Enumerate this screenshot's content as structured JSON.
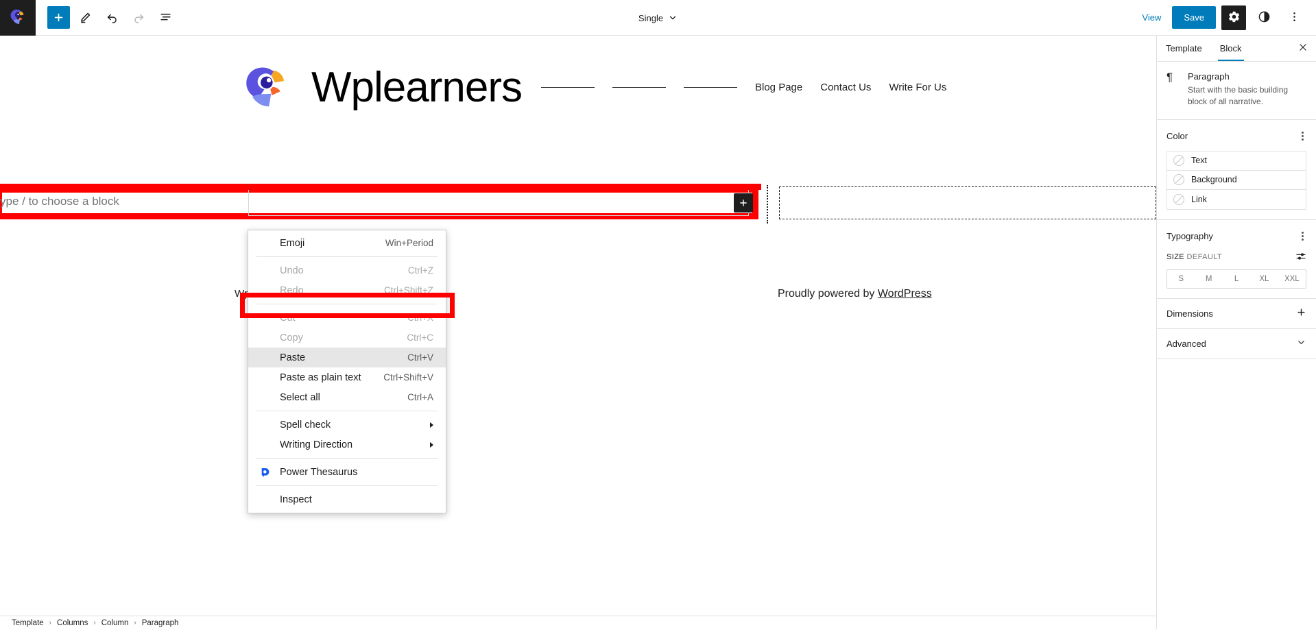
{
  "topbar": {
    "wp_logo_icon": "wordpress-bird-logo-icon",
    "add_block_label": "+",
    "tools": [
      {
        "name": "add-block-button",
        "icon": "plus-icon"
      },
      {
        "name": "edit-tools-button",
        "icon": "pencil-icon"
      },
      {
        "name": "undo-button",
        "icon": "undo-arrow-icon"
      },
      {
        "name": "redo-button",
        "icon": "redo-arrow-icon"
      },
      {
        "name": "list-view-button",
        "icon": "list-view-icon"
      }
    ],
    "document_title": "Single",
    "document_chevron_icon": "chevron-down-icon",
    "view_label": "View",
    "save_label": "Save",
    "settings_icon": "gear-icon",
    "styles_icon": "contrast-half-circle-icon",
    "options_icon": "vertical-ellipsis-icon"
  },
  "site": {
    "logo_icon": "parrot-logo-icon",
    "title": "Wplearners",
    "nav_dashes": 3,
    "nav_links": [
      "Blog Page",
      "Contact Us",
      "Write For Us"
    ]
  },
  "editor": {
    "block_placeholder": "ype / to choose a block",
    "block_appender_icon": "plus-icon",
    "hidden_paragraph_text": "Wp",
    "powered_by_prefix": "Proudly powered by ",
    "powered_by_link": "WordPress",
    "column_divider_name": "column-divider",
    "empty_column_name": "empty-column-placeholder"
  },
  "context_menu": {
    "items": [
      {
        "label": "Emoji",
        "accel": "Win+Period",
        "state": "normal",
        "icon": null,
        "submenu": false,
        "sep_after": true
      },
      {
        "label": "Undo",
        "accel": "Ctrl+Z",
        "state": "disabled",
        "icon": null,
        "submenu": false,
        "sep_after": false
      },
      {
        "label": "Redo",
        "accel": "Ctrl+Shift+Z",
        "state": "disabled",
        "icon": null,
        "submenu": false,
        "sep_after": true
      },
      {
        "label": "Cut",
        "accel": "Ctrl+X",
        "state": "disabled",
        "icon": null,
        "submenu": false,
        "sep_after": false
      },
      {
        "label": "Copy",
        "accel": "Ctrl+C",
        "state": "disabled",
        "icon": null,
        "submenu": false,
        "sep_after": false
      },
      {
        "label": "Paste",
        "accel": "Ctrl+V",
        "state": "active",
        "icon": null,
        "submenu": false,
        "sep_after": false
      },
      {
        "label": "Paste as plain text",
        "accel": "Ctrl+Shift+V",
        "state": "normal",
        "icon": null,
        "submenu": false,
        "sep_after": false
      },
      {
        "label": "Select all",
        "accel": "Ctrl+A",
        "state": "normal",
        "icon": null,
        "submenu": false,
        "sep_after": true
      },
      {
        "label": "Spell check",
        "accel": "",
        "state": "normal",
        "icon": null,
        "submenu": true,
        "sep_after": false
      },
      {
        "label": "Writing Direction",
        "accel": "",
        "state": "normal",
        "icon": null,
        "submenu": true,
        "sep_after": true
      },
      {
        "label": "Power Thesaurus",
        "accel": "",
        "state": "normal",
        "icon": "power-thesaurus-icon",
        "submenu": false,
        "sep_after": true
      },
      {
        "label": "Inspect",
        "accel": "",
        "state": "normal",
        "icon": null,
        "submenu": false,
        "sep_after": false
      }
    ]
  },
  "sidebar": {
    "tabs": [
      {
        "label": "Template",
        "selected": false
      },
      {
        "label": "Block",
        "selected": true
      }
    ],
    "close_icon": "close-x-icon",
    "block": {
      "icon": "paragraph-pilcrow-icon",
      "title": "Paragraph",
      "description": "Start with the basic building block of all narrative."
    },
    "color": {
      "title": "Color",
      "options_icon": "vertical-ellipsis-icon",
      "rows": [
        {
          "label": "Text",
          "swatch": "none"
        },
        {
          "label": "Background",
          "swatch": "none"
        },
        {
          "label": "Link",
          "swatch": "none"
        }
      ]
    },
    "typography": {
      "title": "Typography",
      "options_icon": "vertical-ellipsis-icon",
      "size_label": "SIZE",
      "size_value": "DEFAULT",
      "size_settings_icon": "sliders-icon",
      "sizes": [
        "S",
        "M",
        "L",
        "XL",
        "XXL"
      ]
    },
    "dimensions": {
      "title": "Dimensions",
      "icon": "plus-icon"
    },
    "advanced": {
      "title": "Advanced",
      "icon": "chevron-down-icon"
    }
  },
  "breadcrumb": {
    "separator": "›",
    "items": [
      "Template",
      "Columns",
      "Column",
      "Paragraph"
    ]
  },
  "colors": {
    "accent": "#007cba",
    "highlight": "#ff0000",
    "dark": "#1e1e1e"
  }
}
